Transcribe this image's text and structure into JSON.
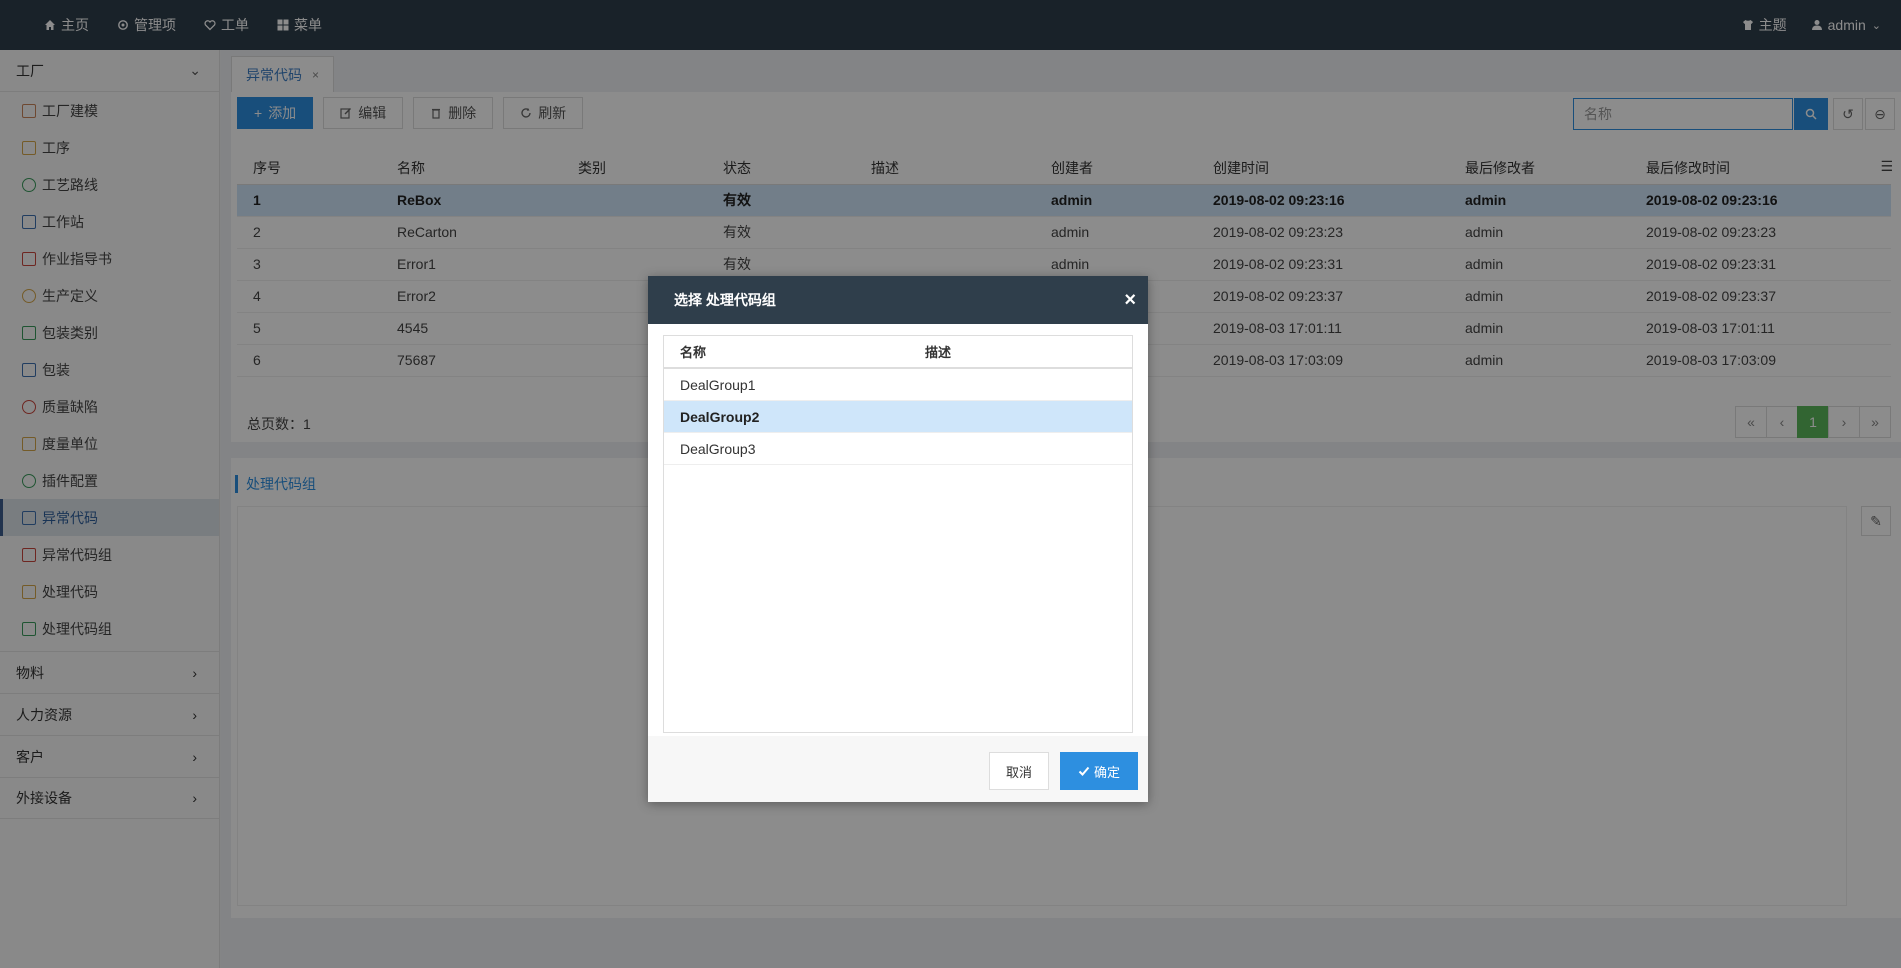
{
  "topnav": {
    "items": [
      {
        "label": "主页",
        "icon": "home-icon"
      },
      {
        "label": "管理项",
        "icon": "cog-icon"
      },
      {
        "label": "工单",
        "icon": "heart-icon"
      },
      {
        "label": "菜单",
        "icon": "grid-icon"
      }
    ],
    "theme_label": "主题",
    "user_label": "admin"
  },
  "sidebar": {
    "group_title": "工厂",
    "items": [
      {
        "label": "工厂建模"
      },
      {
        "label": "工序"
      },
      {
        "label": "工艺路线"
      },
      {
        "label": "工作站"
      },
      {
        "label": "作业指导书"
      },
      {
        "label": "生产定义"
      },
      {
        "label": "包装类别"
      },
      {
        "label": "包装"
      },
      {
        "label": "质量缺陷"
      },
      {
        "label": "度量单位"
      },
      {
        "label": "插件配置"
      },
      {
        "label": "异常代码"
      },
      {
        "label": "异常代码组"
      },
      {
        "label": "处理代码"
      },
      {
        "label": "处理代码组"
      }
    ],
    "collapsed_groups": [
      {
        "label": "物料"
      },
      {
        "label": "人力资源"
      },
      {
        "label": "客户"
      },
      {
        "label": "外接设备"
      }
    ]
  },
  "tabs": [
    {
      "label": "异常代码"
    }
  ],
  "toolbar": {
    "add_label": "添加",
    "edit_label": "编辑",
    "delete_label": "删除",
    "refresh_label": "刷新",
    "search_placeholder": "名称"
  },
  "grid": {
    "columns": [
      "序号",
      "名称",
      "类别",
      "状态",
      "描述",
      "创建者",
      "创建时间",
      "最后修改者",
      "最后修改时间"
    ],
    "rows": [
      [
        "1",
        "ReBox",
        "",
        "有效",
        "",
        "admin",
        "2019-08-02 09:23:16",
        "admin",
        "2019-08-02 09:23:16"
      ],
      [
        "2",
        "ReCarton",
        "",
        "有效",
        "",
        "admin",
        "2019-08-02 09:23:23",
        "admin",
        "2019-08-02 09:23:23"
      ],
      [
        "3",
        "Error1",
        "",
        "有效",
        "",
        "admin",
        "2019-08-02 09:23:31",
        "admin",
        "2019-08-02 09:23:31"
      ],
      [
        "4",
        "Error2",
        "",
        "",
        "",
        "",
        "2019-08-02 09:23:37",
        "admin",
        "2019-08-02 09:23:37"
      ],
      [
        "5",
        "4545",
        "",
        "",
        "",
        "",
        "2019-08-03 17:01:11",
        "admin",
        "2019-08-03 17:01:11"
      ],
      [
        "6",
        "75687",
        "",
        "",
        "",
        "",
        "2019-08-03 17:03:09",
        "admin",
        "2019-08-03 17:03:09"
      ]
    ],
    "selected_row": 0,
    "total_pages_label": "总页数：1",
    "current_page": "1"
  },
  "lower": {
    "section_title": "处理代码组"
  },
  "modal": {
    "title": "选择 处理代码组",
    "close_glyph": "×",
    "columns": [
      "名称",
      "描述"
    ],
    "rows": [
      {
        "name": "DealGroup1",
        "desc": ""
      },
      {
        "name": "DealGroup2",
        "desc": ""
      },
      {
        "name": "DealGroup3",
        "desc": ""
      }
    ],
    "selected_row": 1,
    "cancel_label": "取消",
    "ok_label": "确定"
  },
  "colors": {
    "topbar": "#2f3e4b",
    "primary": "#2d8fe0",
    "selected_row": "#cfe6fa",
    "pager_current": "#5cb85c"
  }
}
